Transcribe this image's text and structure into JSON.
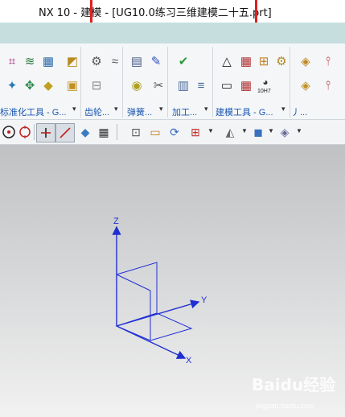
{
  "window": {
    "title_app": "NX 10 - 建模 -",
    "title_file": "[UG10.0练习三维建模二十五.prt]"
  },
  "ribbon_groups": [
    {
      "label": "标准化工具 - G...",
      "id": "standardization-tools"
    },
    {
      "label": "齿轮...",
      "id": "gear"
    },
    {
      "label": "弹簧...",
      "id": "spring"
    },
    {
      "label": "加工...",
      "id": "machining"
    },
    {
      "label": "建模工具 - G...",
      "id": "modeling-tools"
    },
    {
      "label": "丿...",
      "id": "more"
    }
  ],
  "ribbon_icons": {
    "row1": [
      "assembly-icon",
      "layers-icon",
      "table-icon",
      "fastener-icon",
      "gear-icon",
      "spring-icon",
      "cylinder-icon",
      "pen-icon",
      "check-icon",
      "triangle-icon",
      "grid-table-icon",
      "bolt-icon",
      "part-icon",
      "dimension-icon"
    ],
    "row2": [
      "wizard-icon",
      "model-icon",
      "tool-icon",
      "folder-icon",
      "gear2-icon",
      "spring2-icon",
      "reel-icon",
      "cut-icon",
      "sheet-icon",
      "doc-icon",
      "hole-icon",
      "tolerance-icon",
      "part2-icon",
      "dimension2-icon"
    ],
    "tolerance_label": "10H7"
  },
  "toolbar2": [
    "select-circle-icon",
    "crosshair-icon",
    "plus-icon",
    "line-icon",
    "grid-icon",
    "sketch-icon",
    "zoom-fit-icon",
    "rectangle-icon",
    "rotate-icon",
    "snap-icon",
    "shading-icon",
    "box-icon",
    "arrow-icon"
  ],
  "axes": {
    "z": "Z",
    "y": "Y",
    "x": "X"
  },
  "watermark": {
    "brand": "Baidu经验",
    "url": "jingyan.baidu.com"
  },
  "colors": {
    "axis": "#1f2fd1",
    "csys": "#2030d8",
    "highlight": "#e02020",
    "ribbon_strip": "#c6dede"
  }
}
